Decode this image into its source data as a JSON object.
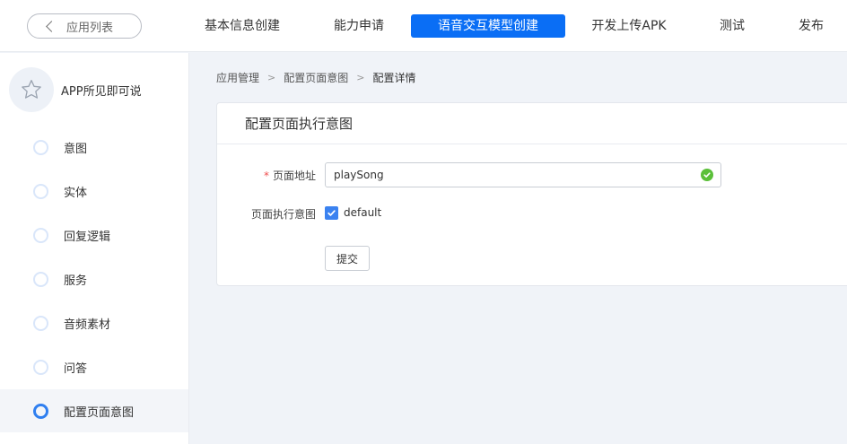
{
  "header": {
    "back_label": "应用列表",
    "tabs": [
      {
        "label": "基本信息创建",
        "active": false
      },
      {
        "label": "能力申请",
        "active": false
      },
      {
        "label": "语音交互模型创建",
        "active": true
      },
      {
        "label": "开发上传APK",
        "active": false
      },
      {
        "label": "测试",
        "active": false
      },
      {
        "label": "发布",
        "active": false
      }
    ],
    "accent_color": "#0a6ef5"
  },
  "sidebar": {
    "app_name": "APP所见即可说",
    "app_icon": "star-icon",
    "items": [
      {
        "label": "意图",
        "active": false
      },
      {
        "label": "实体",
        "active": false
      },
      {
        "label": "回复逻辑",
        "active": false
      },
      {
        "label": "服务",
        "active": false
      },
      {
        "label": "音频素材",
        "active": false
      },
      {
        "label": "问答",
        "active": false
      },
      {
        "label": "配置页面意图",
        "active": true
      }
    ]
  },
  "breadcrumb": {
    "items": [
      "应用管理",
      "配置页面意图",
      "配置详情"
    ]
  },
  "form": {
    "title": "配置页面执行意图",
    "page_address_label": "页面地址",
    "page_address_value": "playSong",
    "intent_label": "页面执行意图",
    "intent_option": "default",
    "intent_checked": true,
    "submit_label": "提交"
  }
}
